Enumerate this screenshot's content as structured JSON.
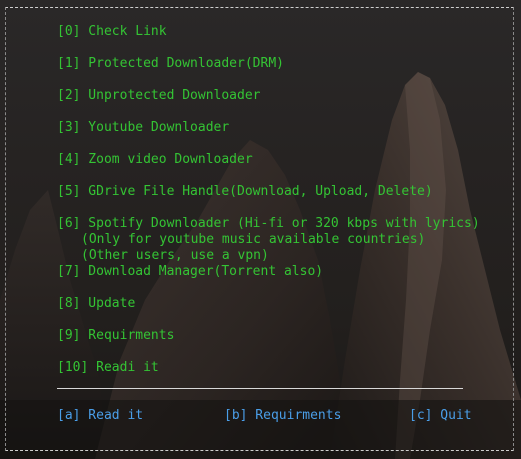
{
  "menu": {
    "items": [
      {
        "label": "[0] Check Link"
      },
      {
        "label": "[1] Protected Downloader(DRM)"
      },
      {
        "label": "[2] Unprotected Downloader"
      },
      {
        "label": "[3] Youtube Downloader"
      },
      {
        "label": "[4] Zoom video Downloader"
      },
      {
        "label": "[5] GDrive File Handle(Download, Upload, Delete)"
      },
      {
        "label": "[6] Spotify Downloader (Hi-fi or 320 kbps with lyrics)"
      },
      {
        "label": "[7] Download Manager(Torrent also)"
      },
      {
        "label": "[8] Update"
      },
      {
        "label": "[9] Requirments"
      },
      {
        "label": "[10] Readi it"
      }
    ],
    "spotify_notes": [
      "(Only for youtube music available countries)",
      "(Other users, use a vpn)"
    ]
  },
  "actions": {
    "read": "[a] Read it",
    "requirements": "[b] Requirments",
    "quit": "[c] Quit"
  },
  "colors": {
    "menu_text": "#34c434",
    "action_text": "#4a9ee8",
    "frame": "#cfcfcf",
    "background": "#242120"
  }
}
